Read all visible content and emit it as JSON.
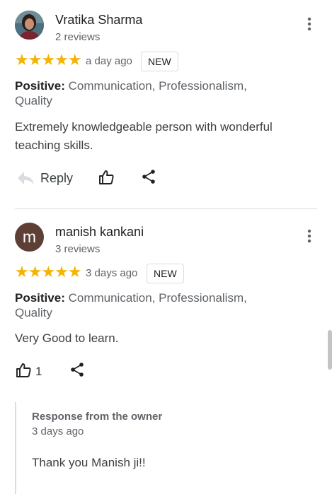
{
  "reviews": [
    {
      "name": "Vratika Sharma",
      "review_count": "2 reviews",
      "rating": 5,
      "stars": "★★★★★",
      "age": "a day ago",
      "badge": "NEW",
      "positive_label": "Positive:",
      "positive_items": " Communication, Professionalism, Quality",
      "text": "Extremely knowledgeable person with wonderful teaching skills.",
      "reply_label": "Reply"
    },
    {
      "name": "manish kankani",
      "avatar_letter": "m",
      "review_count": "3 reviews",
      "rating": 5,
      "stars": "★★★★★",
      "age": "3 days ago",
      "badge": "NEW",
      "positive_label": "Positive:",
      "positive_items": " Communication, Professionalism, Quality",
      "text": "Very Good to learn.",
      "like_count": "1",
      "owner_response": {
        "title": "Response from the owner",
        "age": "3 days ago",
        "text": "Thank you Manish ji!!"
      }
    }
  ],
  "colors": {
    "star": "#f4b400",
    "avatar_letter_bg": "#5d3f35",
    "divider": "#dadce0"
  }
}
